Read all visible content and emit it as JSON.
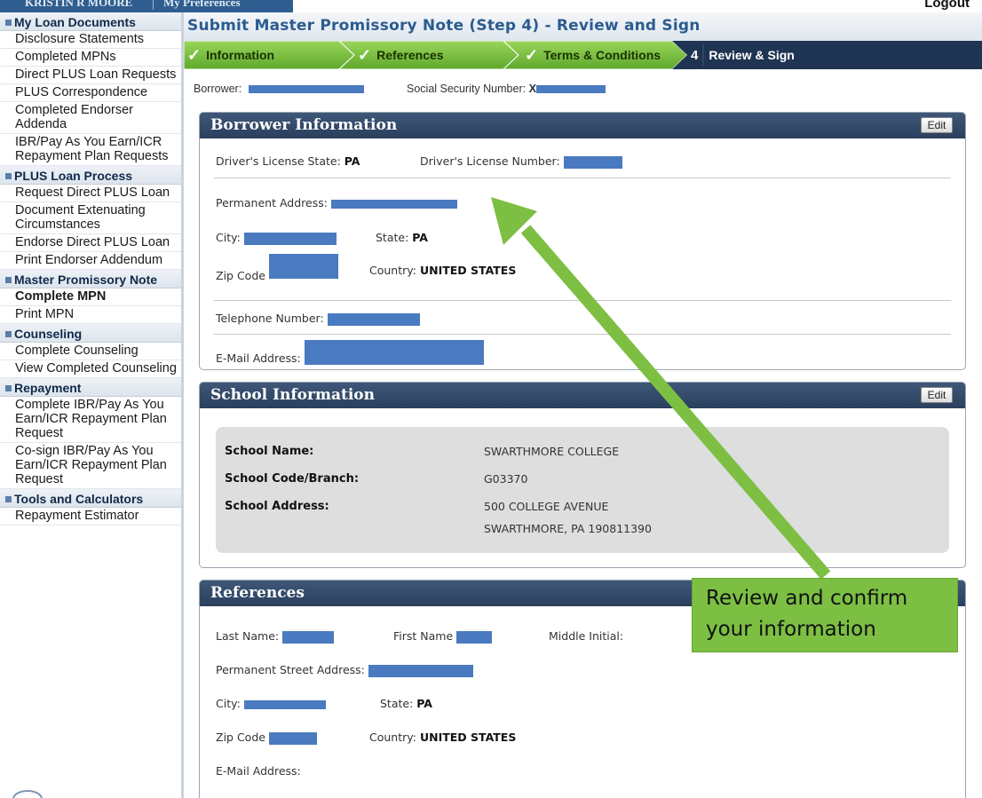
{
  "topbar": {
    "user_name": "KRISTIN R MOORE",
    "preferences": "My Preferences",
    "logout": "Logout"
  },
  "sidebar": [
    {
      "title": "My Loan Documents",
      "items": [
        {
          "label": "Disclosure Statements"
        },
        {
          "label": "Completed MPNs"
        },
        {
          "label": "Direct PLUS Loan Requests"
        },
        {
          "label": "PLUS Correspondence"
        },
        {
          "label": "Completed Endorser Addenda"
        },
        {
          "label": "IBR/Pay As You Earn/ICR Repayment Plan Requests"
        }
      ]
    },
    {
      "title": "PLUS Loan Process",
      "items": [
        {
          "label": "Request Direct PLUS Loan"
        },
        {
          "label": "Document Extenuating Circumstances"
        },
        {
          "label": "Endorse Direct PLUS Loan"
        },
        {
          "label": "Print Endorser Addendum"
        }
      ]
    },
    {
      "title": "Master Promissory Note",
      "items": [
        {
          "label": "Complete MPN",
          "active": true
        },
        {
          "label": "Print MPN"
        }
      ]
    },
    {
      "title": "Counseling",
      "items": [
        {
          "label": "Complete Counseling"
        },
        {
          "label": "View Completed Counseling"
        }
      ]
    },
    {
      "title": "Repayment",
      "items": [
        {
          "label": "Complete IBR/Pay As You Earn/ICR Repayment Plan Request"
        },
        {
          "label": "Co-sign IBR/Pay As You Earn/ICR Repayment Plan Request"
        }
      ]
    },
    {
      "title": "Tools and Calculators",
      "items": [
        {
          "label": "Repayment Estimator"
        }
      ]
    }
  ],
  "page_title": "Submit Master Promissory Note (Step 4) - Review and Sign",
  "steps": [
    {
      "label": "Information",
      "status": "done"
    },
    {
      "label": "References",
      "status": "done"
    },
    {
      "label": "Terms & Conditions",
      "status": "done"
    },
    {
      "number": "4",
      "label": "Review & Sign",
      "status": "current"
    }
  ],
  "borrower_line": {
    "borrower_label": "Borrower:",
    "ssn_label": "Social Security Number:",
    "ssn_prefix": "X"
  },
  "borrower_info": {
    "title": "Borrower Information",
    "edit": "Edit",
    "dl_state_label": "Driver's License State:",
    "dl_state": "PA",
    "dl_number_label": "Driver's License Number:",
    "address_label": "Permanent Address:",
    "city_label": "City:",
    "state_label": "State:",
    "state": "PA",
    "zip_label": "Zip Code",
    "country_label": "Country:",
    "country": "UNITED STATES",
    "phone_label": "Telephone Number:",
    "email_label": "E-Mail Address:"
  },
  "school_info": {
    "title": "School Information",
    "edit": "Edit",
    "name_label": "School Name:",
    "name": "SWARTHMORE COLLEGE",
    "code_label": "School Code/Branch:",
    "code": "G03370",
    "address_label": "School Address:",
    "address_line1": "500 COLLEGE AVENUE",
    "address_line2": "SWARTHMORE, PA 190811390"
  },
  "references": {
    "title": "References",
    "last_name_label": "Last Name:",
    "first_name_label": "First Name",
    "middle_initial_label": "Middle Initial:",
    "street_label": "Permanent Street Address:",
    "city_label": "City:",
    "state_label": "State:",
    "state": "PA",
    "zip_label": "Zip Code",
    "country_label": "Country:",
    "country": "UNITED STATES",
    "email_label": "E-Mail Address:"
  },
  "callout": {
    "line1": "Review and confirm",
    "line2": "your information"
  },
  "colors": {
    "header_blue": "#2b5c8f",
    "step_green": "#7cc242",
    "panel_head": "#2f4566",
    "callout_green": "#7cbf43",
    "redaction": "#4a7ac0"
  }
}
